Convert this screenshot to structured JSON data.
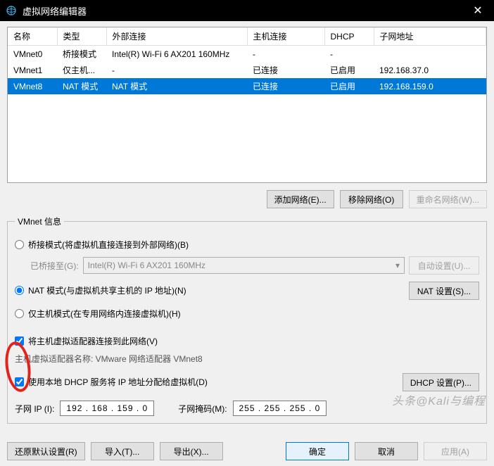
{
  "titlebar": {
    "title": "虚拟网络编辑器",
    "close": "✕"
  },
  "table": {
    "headers": {
      "name": "名称",
      "type": "类型",
      "ext": "外部连接",
      "host": "主机连接",
      "dhcp": "DHCP",
      "subnet": "子网地址"
    },
    "rows": [
      {
        "name": "VMnet0",
        "type": "桥接模式",
        "ext": "Intel(R) Wi-Fi 6 AX201 160MHz",
        "host": "-",
        "dhcp": "-",
        "subnet": ""
      },
      {
        "name": "VMnet1",
        "type": "仅主机...",
        "ext": "-",
        "host": "已连接",
        "dhcp": "已启用",
        "subnet": "192.168.37.0"
      },
      {
        "name": "VMnet8",
        "type": "NAT 模式",
        "ext": "NAT 模式",
        "host": "已连接",
        "dhcp": "已启用",
        "subnet": "192.168.159.0"
      }
    ]
  },
  "buttons": {
    "add_net": "添加网络(E)...",
    "remove_net": "移除网络(O)",
    "rename_net": "重命名网络(W)..."
  },
  "vmnet_info": {
    "legend": "VMnet 信息",
    "bridge_radio": "桥接模式(将虚拟机直接连接到外部网络)(B)",
    "bridge_to_label": "已桥接至(G):",
    "bridge_adapter": "Intel(R) Wi-Fi 6 AX201 160MHz",
    "auto_set": "自动设置(U)...",
    "nat_radio": "NAT 模式(与虚拟机共享主机的 IP 地址)(N)",
    "nat_set": "NAT 设置(S)...",
    "host_only_radio": "仅主机模式(在专用网络内连接虚拟机)(H)",
    "connect_host_check": "将主机虚拟适配器连接到此网络(V)",
    "host_adapter_label": "主机虚拟适配器名称: VMware 网络适配器 VMnet8",
    "dhcp_check": "使用本地 DHCP 服务将 IP 地址分配给虚拟机(D)",
    "dhcp_set": "DHCP 设置(P)...",
    "subnet_ip_label": "子网 IP (I):",
    "subnet_ip": "192 . 168 . 159 .  0",
    "subnet_mask_label": "子网掩码(M):",
    "subnet_mask": "255 . 255 . 255 .  0"
  },
  "bottom": {
    "restore": "还原默认设置(R)",
    "import": "导入(T)...",
    "export": "导出(X)...",
    "ok": "确定",
    "cancel": "取消",
    "apply": "应用(A)"
  },
  "watermark": "头条@Kali与编程"
}
